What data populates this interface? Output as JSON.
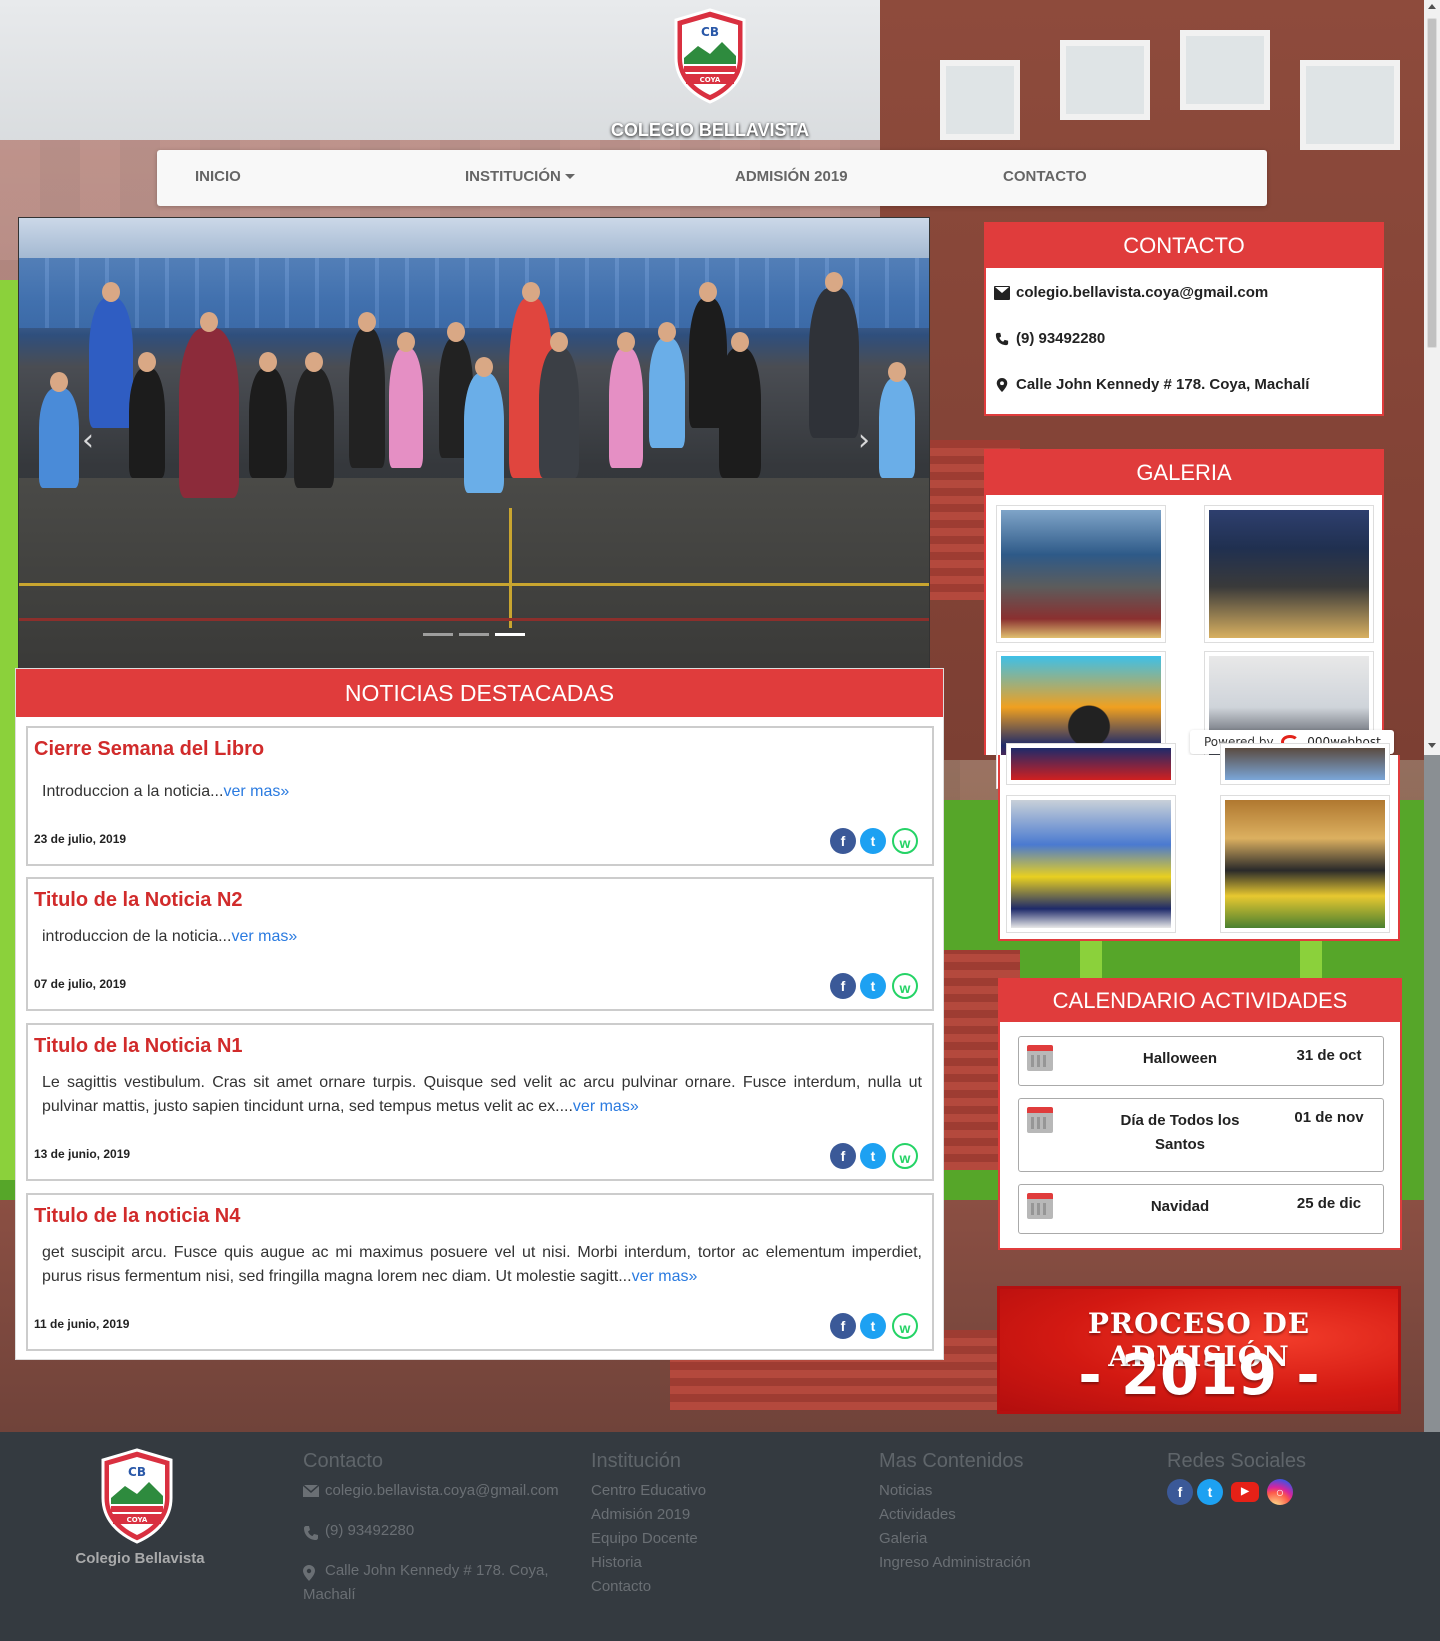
{
  "site": {
    "title": "COLEGIO BELLAVISTA",
    "logo_text_top": "COLEGIO BELLAVISTA",
    "logo_initials": "CB",
    "logo_text_bottom": "COYA"
  },
  "nav": {
    "items": [
      {
        "label": "INICIO"
      },
      {
        "label": "INSTITUCIÓN",
        "dropdown": true
      },
      {
        "label": "ADMISIÓN 2019"
      },
      {
        "label": "CONTACTO"
      }
    ]
  },
  "carousel": {
    "prev_icon": "chevron-left-icon",
    "next_icon": "chevron-right-icon",
    "slides": 3,
    "active_slide": 3
  },
  "contact_card": {
    "title": "CONTACTO",
    "email": "colegio.bellavista.coya@gmail.com",
    "phone": "(9) 93492280",
    "address": "Calle John Kennedy # 178. Coya, Machalí"
  },
  "gallery": {
    "title": "GALERIA",
    "powered_by_label": "Powered by",
    "powered_by_brand": "000webhost"
  },
  "news": {
    "title": "NOTICIAS DESTACADAS",
    "read_more": "ver mas»",
    "items": [
      {
        "title": "Cierre Semana del Libro",
        "body": "Introduccion a la noticia...",
        "date": "23 de julio, 2019"
      },
      {
        "title": "Titulo de la Noticia N2",
        "body": "introduccion de la noticia...",
        "date": "07 de julio, 2019"
      },
      {
        "title": "Titulo de la Noticia N1",
        "body": "Le sagittis vestibulum. Cras sit amet ornare turpis. Quisque sed velit ac arcu pulvinar ornare. Fusce interdum, nulla ut pulvinar mattis, justo sapien tincidunt urna, sed tempus metus velit ac ex....",
        "date": "13 de junio, 2019"
      },
      {
        "title": "Titulo de la noticia N4",
        "body": "get suscipit arcu. Fusce quis augue ac mi maximus posuere vel ut nisi. Morbi interdum, tortor ac elementum imperdiet, purus risus fermentum nisi, sed fringilla magna lorem nec diam. Ut molestie sagitt...",
        "date": "11 de junio, 2019"
      }
    ]
  },
  "calendar": {
    "title": "CALENDARIO ACTIVIDADES",
    "events": [
      {
        "name": "Halloween",
        "date": "31 de oct"
      },
      {
        "name": "Día de Todos los Santos",
        "date": "01 de nov"
      },
      {
        "name": "Navidad",
        "date": "25 de dic"
      }
    ]
  },
  "banner": {
    "line1": "PROCESO DE ADMISIÓN",
    "line2": "- 2019 -"
  },
  "footer": {
    "name": "Colegio Bellavista",
    "contact": {
      "heading": "Contacto",
      "email": "colegio.bellavista.coya@gmail.com",
      "phone": "(9) 93492280",
      "address": "Calle John Kennedy # 178. Coya, Machalí"
    },
    "institucion": {
      "heading": "Institución",
      "links": [
        "Centro Educativo",
        "Admisión 2019",
        "Equipo Docente",
        "Historia",
        "Contacto"
      ]
    },
    "mas": {
      "heading": "Mas Contenidos",
      "links": [
        "Noticias",
        "Actividades",
        "Galeria",
        "Ingreso Administración"
      ]
    },
    "redes": {
      "heading": "Redes Sociales",
      "icons": [
        "facebook-icon",
        "twitter-icon",
        "youtube-icon",
        "instagram-icon"
      ]
    }
  },
  "colors": {
    "accent_red": "#e03c3c",
    "news_title": "#d12b2b",
    "link_blue": "#2b7be0",
    "footer_bg": "#343a40"
  }
}
